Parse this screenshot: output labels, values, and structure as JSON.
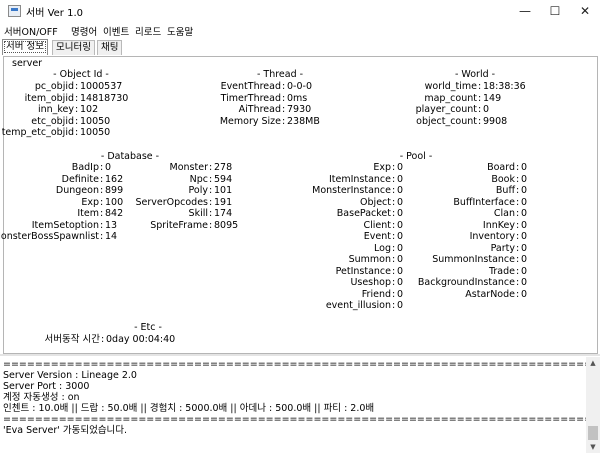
{
  "window": {
    "title": "서버  Ver 1.0"
  },
  "menu": [
    {
      "label": "서버ON/OFF"
    },
    {
      "label": "명령어"
    },
    {
      "label": "이벤트"
    },
    {
      "label": "리로드"
    },
    {
      "label": "도움말"
    }
  ],
  "tabs": [
    {
      "label": "서버 정보"
    },
    {
      "label": "모니터링"
    },
    {
      "label": "채팅"
    }
  ],
  "panel": {
    "label": "server",
    "object_id": {
      "title": "- Object Id -",
      "rows": [
        {
          "k": "pc_objid",
          "v": "1000537"
        },
        {
          "k": "item_objid",
          "v": "14818730"
        },
        {
          "k": "inn_key",
          "v": "102"
        },
        {
          "k": "etc_objid",
          "v": "10050"
        },
        {
          "k": "temp_etc_objid",
          "v": "10050"
        }
      ]
    },
    "thread": {
      "title": "- Thread -",
      "rows": [
        {
          "k": "EventThread",
          "v": "0-0-0"
        },
        {
          "k": "TimerThread",
          "v": "0ms"
        },
        {
          "k": "AiThread",
          "v": "7930"
        },
        {
          "k": "Memory Size",
          "v": "238MB"
        }
      ]
    },
    "world": {
      "title": "- World -",
      "rows": [
        {
          "k": "world_time",
          "v": "18:38:36"
        },
        {
          "k": "map_count",
          "v": "149"
        },
        {
          "k": "player_count",
          "v": "0"
        },
        {
          "k": "object_count",
          "v": "9908"
        }
      ]
    },
    "database": {
      "title": "- Database -",
      "col1": [
        {
          "k": "BadIp",
          "v": "0"
        },
        {
          "k": "Definite",
          "v": "162"
        },
        {
          "k": "Dungeon",
          "v": "899"
        },
        {
          "k": "Exp",
          "v": "100"
        },
        {
          "k": "Item",
          "v": "842"
        },
        {
          "k": "ItemSetoption",
          "v": "13"
        },
        {
          "k": "MonsterBossSpawnlist",
          "v": "14"
        }
      ],
      "col2": [
        {
          "k": "Monster",
          "v": "278"
        },
        {
          "k": "Npc",
          "v": "594"
        },
        {
          "k": "Poly",
          "v": "101"
        },
        {
          "k": "ServerOpcodes",
          "v": "191"
        },
        {
          "k": "Skill",
          "v": "174"
        },
        {
          "k": "SpriteFrame",
          "v": "8095"
        }
      ]
    },
    "pool": {
      "title": "- Pool -",
      "col1": [
        {
          "k": "Exp",
          "v": "0"
        },
        {
          "k": "ItemInstance",
          "v": "0"
        },
        {
          "k": "MonsterInstance",
          "v": "0"
        },
        {
          "k": "Object",
          "v": "0"
        },
        {
          "k": "BasePacket",
          "v": "0"
        },
        {
          "k": "Client",
          "v": "0"
        },
        {
          "k": "Event",
          "v": "0"
        },
        {
          "k": "Log",
          "v": "0"
        },
        {
          "k": "Summon",
          "v": "0"
        },
        {
          "k": "PetInstance",
          "v": "0"
        },
        {
          "k": "Useshop",
          "v": "0"
        },
        {
          "k": "Friend",
          "v": "0"
        },
        {
          "k": "event_illusion",
          "v": "0"
        }
      ],
      "col2": [
        {
          "k": "Board",
          "v": "0"
        },
        {
          "k": "Book",
          "v": "0"
        },
        {
          "k": "Buff",
          "v": "0"
        },
        {
          "k": "BuffInterface",
          "v": "0"
        },
        {
          "k": "Clan",
          "v": "0"
        },
        {
          "k": "InnKey",
          "v": "0"
        },
        {
          "k": "Inventory",
          "v": "0"
        },
        {
          "k": "Party",
          "v": "0"
        },
        {
          "k": "SummonInstance",
          "v": "0"
        },
        {
          "k": "Trade",
          "v": "0"
        },
        {
          "k": "BackgroundInstance",
          "v": "0"
        },
        {
          "k": "AstarNode",
          "v": "0"
        }
      ]
    },
    "etc": {
      "title": "- Etc -",
      "rows": [
        {
          "k": "서버동작 시간",
          "v": "0day 00:04:40"
        }
      ]
    }
  },
  "log": {
    "lines": [
      "================================================================================",
      "Server Version  :  Lineage 2.0",
      "Server Port       :  3000",
      "계정 자동생성  :  on",
      "인첸트 : 10.0배  ||  드랍 : 50.0배  ||  경험치 : 5000.0배  ||  아데나 : 500.0배  ||  파티 : 2.0배",
      "================================================================================",
      "'Eva Server' 가동되었습니다."
    ]
  }
}
